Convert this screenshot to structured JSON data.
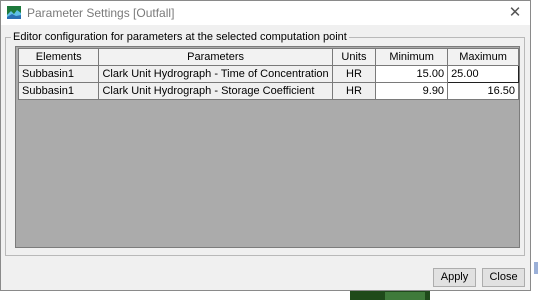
{
  "window": {
    "title": "Parameter Settings [Outfall]",
    "close_glyph": "✕"
  },
  "group": {
    "label": "Editor configuration for parameters at the selected computation point"
  },
  "table": {
    "columns": [
      "Elements",
      "Parameters",
      "Units",
      "Minimum",
      "Maximum"
    ],
    "rows": [
      {
        "element": "Subbasin1",
        "parameter": "Clark Unit Hydrograph - Time of Concentration",
        "units": "HR",
        "minimum": "15.00",
        "maximum": "25.00"
      },
      {
        "element": "Subbasin1",
        "parameter": "Clark Unit Hydrograph - Storage Coefficient",
        "units": "HR",
        "minimum": "9.90",
        "maximum": "16.50"
      }
    ]
  },
  "buttons": {
    "apply": "Apply",
    "close": "Close"
  },
  "colors": {
    "dialog_bg": "#f0f0f0",
    "table_empty_bg": "#ababab"
  }
}
